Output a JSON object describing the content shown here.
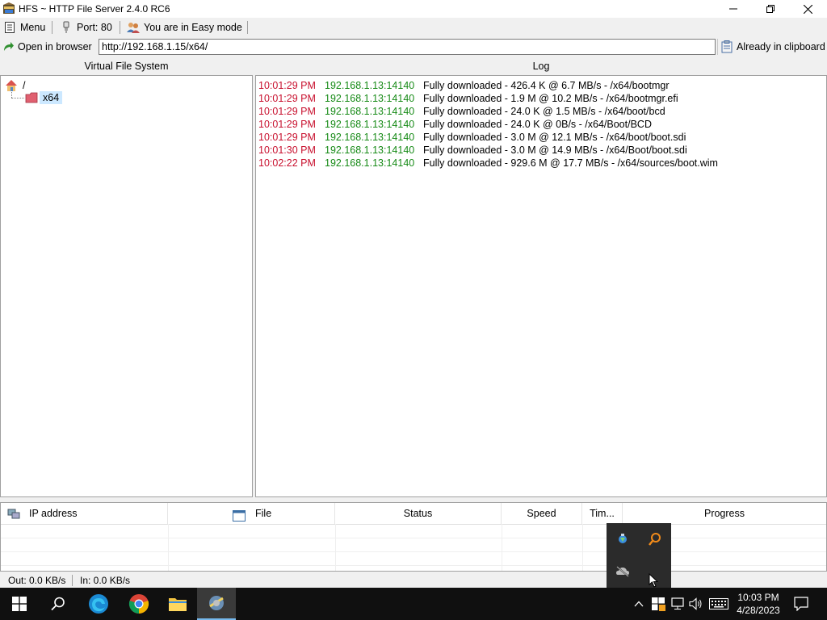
{
  "window": {
    "title": "HFS ~ HTTP File Server 2.4.0 RC6"
  },
  "toolbar": {
    "menu_label": "Menu",
    "port_label": "Port: 80",
    "mode_label": "You are in Easy mode"
  },
  "addressbar": {
    "open_browser_label": "Open in browser",
    "url": "http://192.168.1.15/x64/",
    "clipboard_label": "Already in clipboard"
  },
  "vfs": {
    "header": "Virtual File System",
    "root_label": "/",
    "items": [
      {
        "label": "x64",
        "selected": true
      }
    ]
  },
  "log": {
    "header": "Log",
    "entries": [
      {
        "time": "10:01:29 PM",
        "ip": "192.168.1.13:14140",
        "message": "Fully downloaded - 426.4 K @ 6.7 MB/s - /x64/bootmgr"
      },
      {
        "time": "10:01:29 PM",
        "ip": "192.168.1.13:14140",
        "message": "Fully downloaded - 1.9 M @ 10.2 MB/s - /x64/bootmgr.efi"
      },
      {
        "time": "10:01:29 PM",
        "ip": "192.168.1.13:14140",
        "message": "Fully downloaded - 24.0 K @ 1.5 MB/s - /x64/boot/bcd"
      },
      {
        "time": "10:01:29 PM",
        "ip": "192.168.1.13:14140",
        "message": "Fully downloaded - 24.0 K @ 0B/s - /x64/Boot/BCD"
      },
      {
        "time": "10:01:29 PM",
        "ip": "192.168.1.13:14140",
        "message": "Fully downloaded - 3.0 M @ 12.1 MB/s - /x64/boot/boot.sdi"
      },
      {
        "time": "10:01:30 PM",
        "ip": "192.168.1.13:14140",
        "message": "Fully downloaded - 3.0 M @ 14.9 MB/s - /x64/Boot/boot.sdi"
      },
      {
        "time": "10:02:22 PM",
        "ip": "192.168.1.13:14140",
        "message": "Fully downloaded - 929.6 M @ 17.7 MB/s - /x64/sources/boot.wim"
      }
    ]
  },
  "connections": {
    "columns": [
      "IP address",
      "File",
      "Status",
      "Speed",
      "Tim...",
      "Progress"
    ]
  },
  "statusbar": {
    "out": "Out: 0.0 KB/s",
    "in": "In: 0.0 KB/s"
  },
  "taskbar": {
    "time": "10:03 PM",
    "date": "4/28/2023"
  },
  "colors": {
    "log_time": "#c8102e",
    "log_ip": "#168a16",
    "selection": "#cce8ff",
    "taskbar": "#101010"
  }
}
